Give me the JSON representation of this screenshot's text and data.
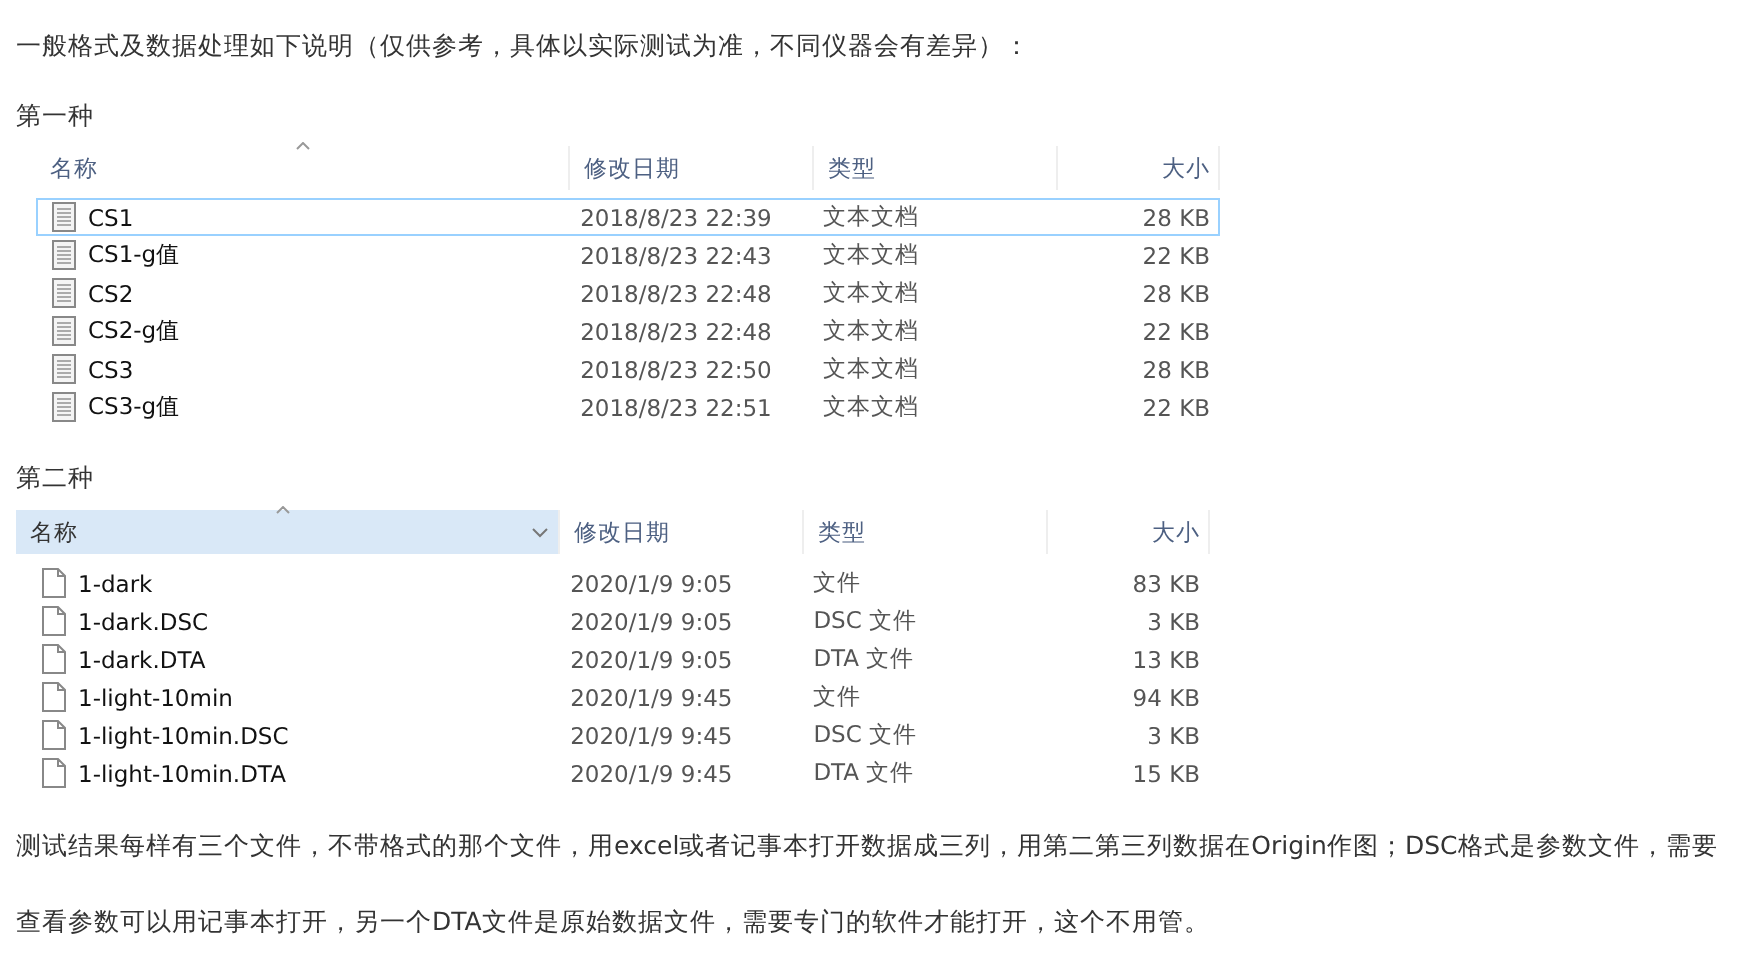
{
  "intro": "一般格式及数据处理如下说明（仅供参考，具体以实际测试为准，不同仪器会有差异）：",
  "sections": [
    {
      "heading": "第一种",
      "kind": "text-file",
      "columns": [
        {
          "label": "名称",
          "sorted": true,
          "selected": false
        },
        {
          "label": "修改日期",
          "sorted": false,
          "selected": false
        },
        {
          "label": "类型",
          "sorted": false,
          "selected": false
        },
        {
          "label": "大小",
          "sorted": false,
          "selected": false
        }
      ],
      "rows": [
        {
          "name": "CS1",
          "date": "2018/8/23 22:39",
          "type": "文本文档",
          "size": "28 KB",
          "selected": true
        },
        {
          "name": "CS1-g值",
          "date": "2018/8/23 22:43",
          "type": "文本文档",
          "size": "22 KB",
          "selected": false
        },
        {
          "name": "CS2",
          "date": "2018/8/23 22:48",
          "type": "文本文档",
          "size": "28 KB",
          "selected": false
        },
        {
          "name": "CS2-g值",
          "date": "2018/8/23 22:48",
          "type": "文本文档",
          "size": "22 KB",
          "selected": false
        },
        {
          "name": "CS3",
          "date": "2018/8/23 22:50",
          "type": "文本文档",
          "size": "28 KB",
          "selected": false
        },
        {
          "name": "CS3-g值",
          "date": "2018/8/23 22:51",
          "type": "文本文档",
          "size": "22 KB",
          "selected": false
        }
      ]
    },
    {
      "heading": "第二种",
      "kind": "plain-file",
      "columns": [
        {
          "label": "名称",
          "sorted": true,
          "selected": true
        },
        {
          "label": "修改日期",
          "sorted": false,
          "selected": false
        },
        {
          "label": "类型",
          "sorted": false,
          "selected": false
        },
        {
          "label": "大小",
          "sorted": false,
          "selected": false
        }
      ],
      "rows": [
        {
          "name": "1-dark",
          "date": "2020/1/9 9:05",
          "type": "文件",
          "size": "83 KB",
          "selected": false
        },
        {
          "name": "1-dark.DSC",
          "date": "2020/1/9 9:05",
          "type": "DSC 文件",
          "size": "3 KB",
          "selected": false
        },
        {
          "name": "1-dark.DTA",
          "date": "2020/1/9 9:05",
          "type": "DTA 文件",
          "size": "13 KB",
          "selected": false
        },
        {
          "name": "1-light-10min",
          "date": "2020/1/9 9:45",
          "type": "文件",
          "size": "94 KB",
          "selected": false
        },
        {
          "name": "1-light-10min.DSC",
          "date": "2020/1/9 9:45",
          "type": "DSC 文件",
          "size": "3 KB",
          "selected": false
        },
        {
          "name": "1-light-10min.DTA",
          "date": "2020/1/9 9:45",
          "type": "DTA 文件",
          "size": "15 KB",
          "selected": false
        }
      ]
    }
  ],
  "outro": "测试结果每样有三个文件，不带格式的那个文件，用excel或者记事本打开数据成三列，用第二第三列数据在Origin作图；DSC格式是参数文件，需要查看参数可以用记事本打开，另一个DTA文件是原始数据文件，需要专门的软件才能打开，这个不用管。"
}
